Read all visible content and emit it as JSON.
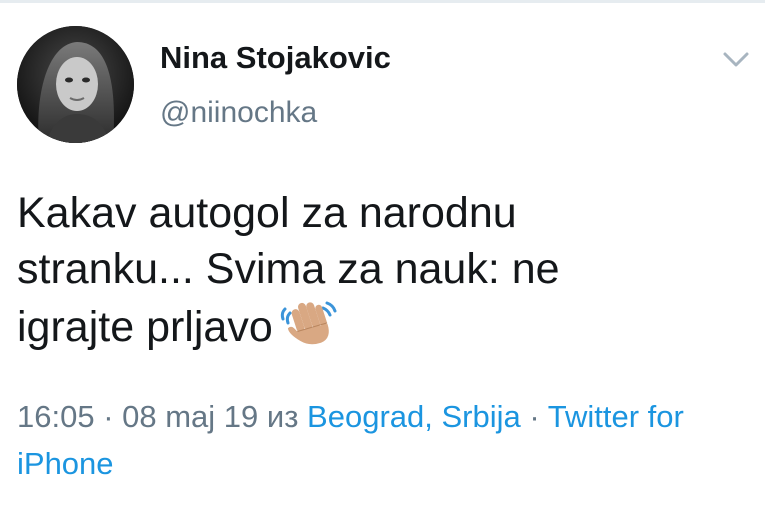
{
  "tweet": {
    "display_name": "Nina Stojakovic",
    "handle": "@niinochka",
    "text_line1": "Kakav autogol za narodnu",
    "text_line2": "stranku... Svima za nauk: ne",
    "text_line3": "igrajte prljavo",
    "emoji": "waving-hand-emoji",
    "time": "16:05",
    "sep1": " · ",
    "date": "08 maj 19",
    "from_word": " из ",
    "location": "Beograd, Srbija",
    "sep2": " · ",
    "source": "Twitter for iPhone"
  },
  "colors": {
    "text": "#14171a",
    "secondary": "#657786",
    "link": "#1b95e0",
    "divider": "#e6ecf0"
  },
  "icons": {
    "caret": "chevron-down-icon",
    "avatar": "avatar"
  }
}
